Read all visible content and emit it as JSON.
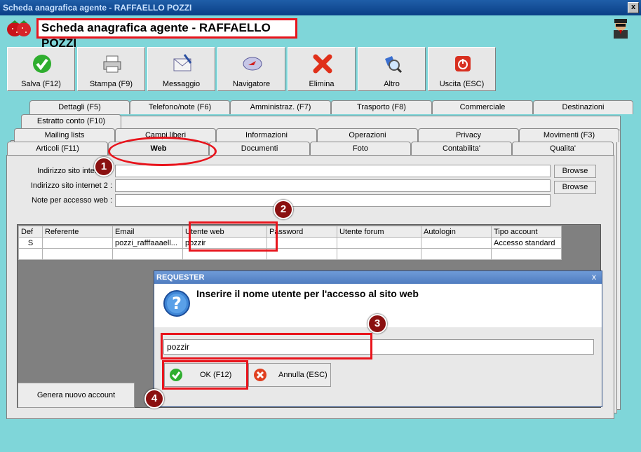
{
  "window": {
    "title": "Scheda anagrafica agente - RAFFAELLO POZZI",
    "close_label": "x"
  },
  "header": {
    "title": "Scheda anagrafica agente - RAFFAELLO POZZI"
  },
  "toolbar": [
    {
      "label": "Salva (F12)",
      "icon": "check-icon"
    },
    {
      "label": "Stampa (F9)",
      "icon": "printer-icon"
    },
    {
      "label": "Messaggio",
      "icon": "envelope-icon"
    },
    {
      "label": "Navigatore",
      "icon": "compass-icon"
    },
    {
      "label": "Elimina",
      "icon": "x-icon"
    },
    {
      "label": "Altro",
      "icon": "search-icon"
    },
    {
      "label": "Uscita (ESC)",
      "icon": "power-icon"
    }
  ],
  "tabs": {
    "row1": [
      "Dettagli (F5)",
      "Telefono/note (F6)",
      "Amministraz. (F7)",
      "Trasporto (F8)",
      "Commerciale",
      "Destinazioni"
    ],
    "row2": [
      "Estratto conto (F10)"
    ],
    "row3": [
      "Mailing lists",
      "Campi liberi",
      "Informazioni",
      "Operazioni",
      "Privacy",
      "Movimenti (F3)"
    ],
    "row4": [
      "Articoli (F11)",
      "Web",
      "Documenti",
      "Foto",
      "Contabilita'",
      "Qualita'"
    ]
  },
  "form": {
    "site1_label": "Indirizzo sito internet :",
    "site2_label": "Indirizzo sito internet 2 :",
    "notes_label": "Note per accesso web :",
    "browse_label": "Browse"
  },
  "grid": {
    "columns": [
      "Def",
      "Referente",
      "Email",
      "Utente web",
      "Password",
      "Utente forum",
      "Autologin",
      "Tipo account"
    ],
    "rows": [
      [
        "S",
        "",
        "pozzi_rafffaaaell...",
        "pozzir",
        "",
        "",
        "",
        "Accesso standard"
      ],
      [
        "",
        "",
        "",
        "",
        "",
        "",
        "",
        ""
      ]
    ]
  },
  "generate_button": "Genera nuovo account",
  "dialog": {
    "title": "REQUESTER",
    "close_label": "x",
    "message": "Inserire il nome utente per l'accesso al sito web",
    "input_value": "pozzir",
    "ok_label": "OK (F12)",
    "cancel_label": "Annulla (ESC)"
  },
  "callouts": [
    "1",
    "2",
    "3",
    "4"
  ],
  "colors": {
    "accent_red": "#e8141c",
    "background": "#7fd6d9",
    "dialog_title": "#4f7cc0"
  }
}
